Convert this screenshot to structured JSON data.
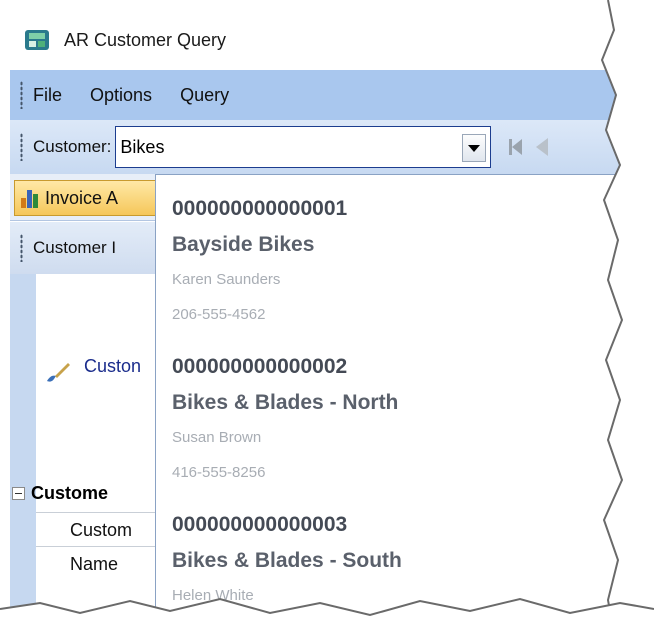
{
  "window": {
    "title": "AR Customer Query"
  },
  "menu": {
    "items": [
      "File",
      "Options",
      "Query"
    ]
  },
  "toolbar": {
    "customer_label": "Customer:",
    "customer_value": "Bikes"
  },
  "tabs": {
    "active_label": "Invoice A"
  },
  "section": {
    "label": "Customer I"
  },
  "panel": {
    "field_link": "Custon",
    "group_header": "Custome",
    "rows": [
      "Custom",
      "Name"
    ]
  },
  "dropdown": {
    "items": [
      {
        "id": "000000000000001",
        "name": "Bayside Bikes",
        "contact": "Karen Saunders",
        "phone": "206-555-4562"
      },
      {
        "id": "000000000000002",
        "name": "Bikes & Blades - North",
        "contact": "Susan Brown",
        "phone": "416-555-8256"
      },
      {
        "id": "000000000000003",
        "name": "Bikes & Blades - South",
        "contact": "Helen White",
        "phone": ""
      }
    ]
  },
  "colors": {
    "menubar": "#a9c7ee",
    "tab_active": "#f5c75a",
    "link": "#1a2c8c"
  },
  "icons": [
    "app-icon",
    "chart-icon",
    "dropdown-arrow-icon",
    "nav-first-icon",
    "nav-prev-icon",
    "brush-icon",
    "collapse-icon"
  ]
}
